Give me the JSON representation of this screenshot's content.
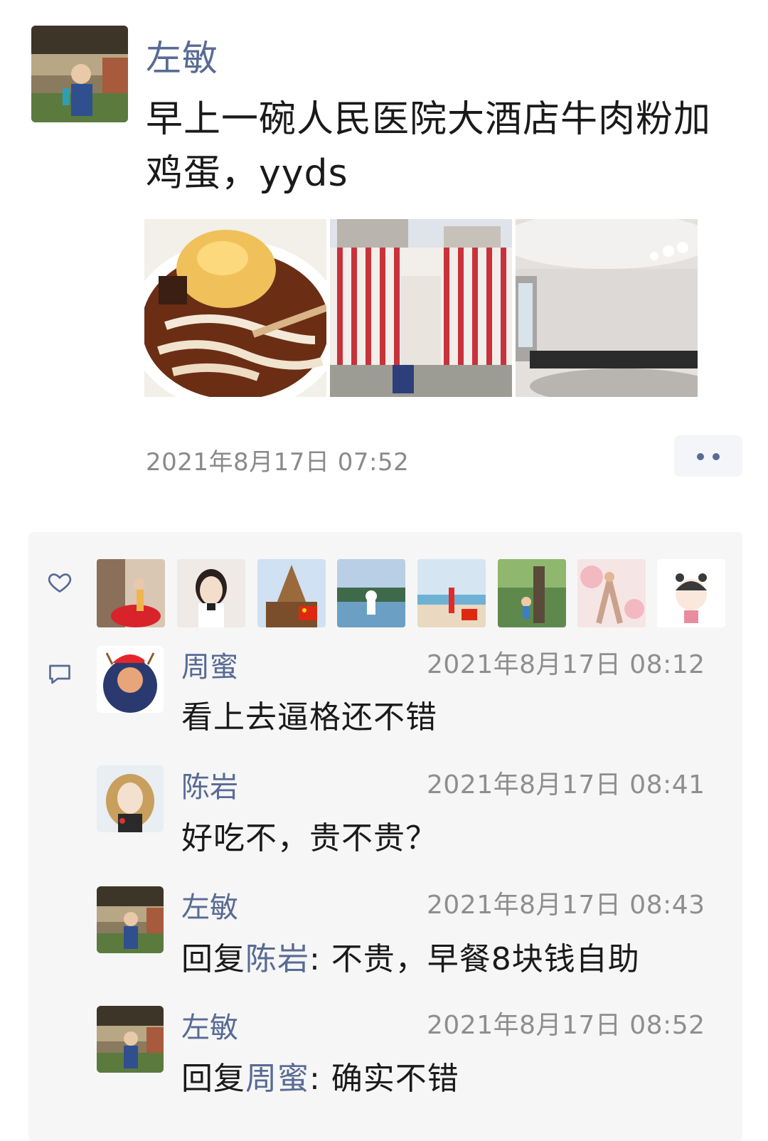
{
  "post": {
    "author": "左敏",
    "text": "早上一碗人民医院大酒店牛肉粉加鸡蛋，yyds",
    "time": "2021年8月17日 07:52",
    "photos": [
      "beef-noodle-egg-photo",
      "hospital-hotel-building-photo",
      "banquet-hall-photo"
    ]
  },
  "likes": {
    "icon": "heart-icon",
    "avatars": [
      "dancer-avatar",
      "woman-glasses-avatar",
      "temple-avatar",
      "beach-group-avatar",
      "beach-red-dress-avatar",
      "park-kid-avatar",
      "yoga-avatar",
      "cartoon-girl-avatar"
    ]
  },
  "comments": [
    {
      "name": "周蜜",
      "time": "2021年8月17日 08:12",
      "text": "看上去逼格还不错"
    },
    {
      "name": "陈岩",
      "time": "2021年8月17日 08:41",
      "text": "好吃不，贵不贵？"
    },
    {
      "name": "左敏",
      "time": "2021年8月17日 08:43",
      "reply_prefix": "回复",
      "reply_to": "陈岩",
      "text": ": 不贵，早餐8块钱自助"
    },
    {
      "name": "左敏",
      "time": "2021年8月17日 08:52",
      "reply_prefix": "回复",
      "reply_to": "周蜜",
      "text": ": 确实不错"
    }
  ],
  "colors": {
    "name_blue": "#586b94",
    "panel_bg": "#f6f6f6",
    "time_gray": "#8a8a8a"
  }
}
